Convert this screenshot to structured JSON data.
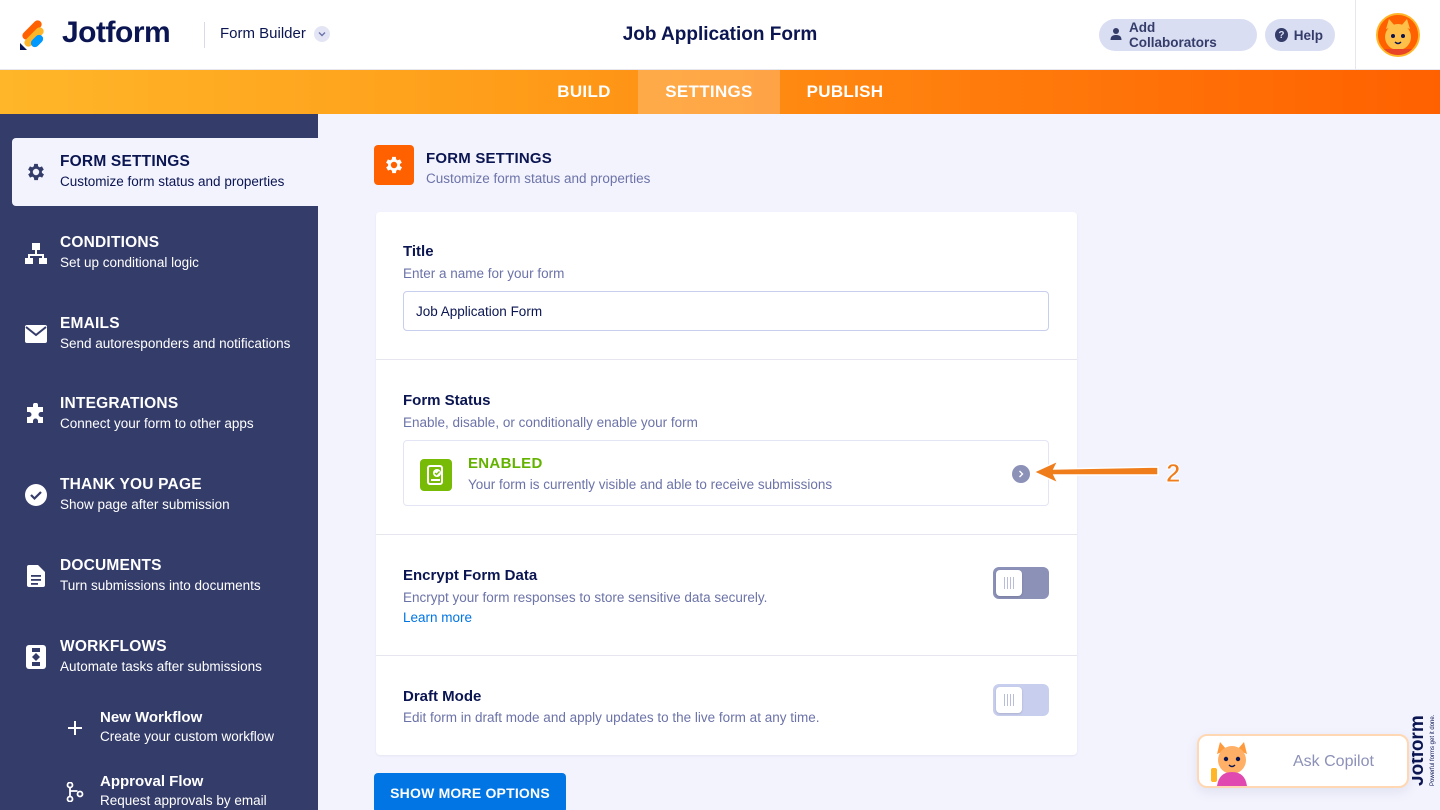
{
  "header": {
    "brand": "Jotform",
    "builder_label": "Form Builder",
    "form_title": "Job Application Form",
    "add_collaborators": "Add Collaborators",
    "help": "Help"
  },
  "tabs": [
    {
      "label": "BUILD",
      "active": false
    },
    {
      "label": "SETTINGS",
      "active": true
    },
    {
      "label": "PUBLISH",
      "active": false
    }
  ],
  "sidebar": {
    "items": [
      {
        "title": "FORM SETTINGS",
        "subtitle": "Customize form status and properties",
        "icon": "gear-icon",
        "active": true
      },
      {
        "title": "CONDITIONS",
        "subtitle": "Set up conditional logic",
        "icon": "conditions-icon"
      },
      {
        "title": "EMAILS",
        "subtitle": "Send autoresponders and notifications",
        "icon": "envelope-icon"
      },
      {
        "title": "INTEGRATIONS",
        "subtitle": "Connect your form to other apps",
        "icon": "puzzle-icon"
      },
      {
        "title": "THANK YOU PAGE",
        "subtitle": "Show page after submission",
        "icon": "check-circle-icon"
      },
      {
        "title": "DOCUMENTS",
        "subtitle": "Turn submissions into documents",
        "icon": "document-icon"
      },
      {
        "title": "WORKFLOWS",
        "subtitle": "Automate tasks after submissions",
        "icon": "workflow-icon"
      }
    ],
    "sub_items": [
      {
        "title": "New Workflow",
        "subtitle": "Create your custom workflow",
        "icon": "plus-icon"
      },
      {
        "title": "Approval Flow",
        "subtitle": "Request approvals by email",
        "icon": "approval-flow-icon"
      }
    ]
  },
  "main": {
    "heading": "FORM SETTINGS",
    "subheading": "Customize form status and properties",
    "title_section": {
      "label": "Title",
      "description": "Enter a name for your form",
      "value": "Job Application Form"
    },
    "status_section": {
      "label": "Form Status",
      "description": "Enable, disable, or conditionally enable your form",
      "status": "ENABLED",
      "status_description": "Your form is currently visible and able to receive submissions"
    },
    "encrypt_section": {
      "label": "Encrypt Form Data",
      "description": "Encrypt your form responses to store sensitive data securely.",
      "link": "Learn more",
      "enabled": false
    },
    "draft_section": {
      "label": "Draft Mode",
      "description": "Edit form in draft mode and apply updates to the live form at any time.",
      "enabled": false
    },
    "show_more": "SHOW MORE OPTIONS"
  },
  "annotation": {
    "number": "2"
  },
  "copilot": {
    "label": "Ask Copilot"
  },
  "side_brand": {
    "name": "Jotform",
    "tagline": "Powerful forms get it done."
  },
  "colors": {
    "accent": "#ff6100",
    "sidebar": "#343c6a",
    "enabled_green": "#64b200",
    "primary_button": "#0075e3",
    "annotation": "#f07d1b"
  }
}
